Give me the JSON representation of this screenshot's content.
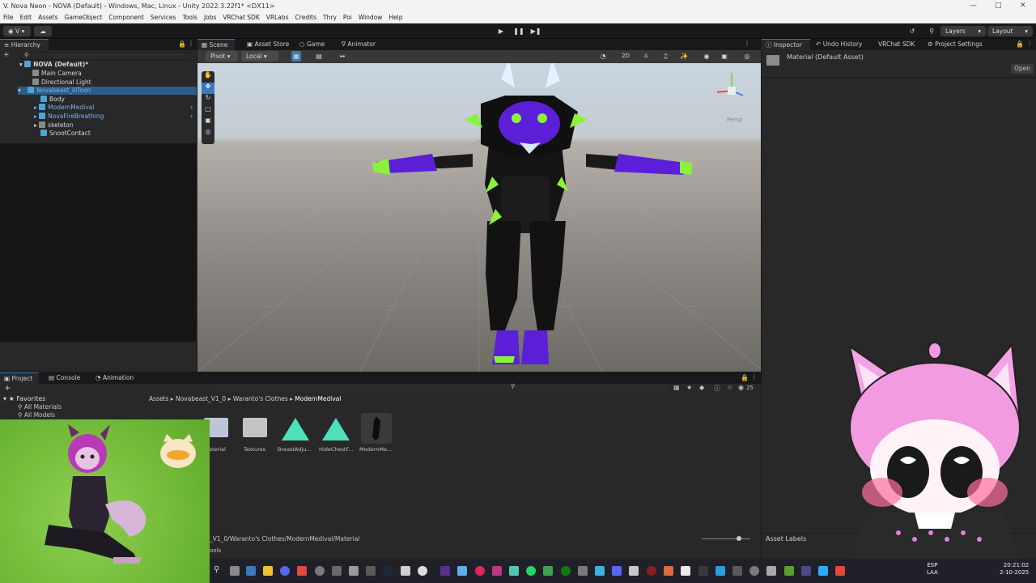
{
  "window": {
    "title": "V. Nova Neon - NOVA (Default) - Windows, Mac, Linux - Unity 2022.3.22f1* <DX11>"
  },
  "menu": [
    "File",
    "Edit",
    "Assets",
    "GameObject",
    "Component",
    "Services",
    "Tools",
    "Jobs",
    "VRChat SDK",
    "VRLabs",
    "Credits",
    "Thry",
    "Poi",
    "Window",
    "Help"
  ],
  "toolbar": {
    "account_label": "V",
    "layers_label": "Layers",
    "layout_label": "Layout"
  },
  "hierarchy": {
    "tab": "Hierarchy",
    "items": [
      {
        "label": "NOVA (Default)*"
      },
      {
        "label": "Main Camera"
      },
      {
        "label": "Directional Light"
      },
      {
        "label": "Novabeast_lilToon"
      },
      {
        "label": "Body"
      },
      {
        "label": "ModernMedival"
      },
      {
        "label": "NovaFireBreathing"
      },
      {
        "label": "skeleton"
      },
      {
        "label": "SnootContact"
      }
    ]
  },
  "scene_tabs": [
    "Scene",
    "Asset Store",
    "Game",
    "Animator"
  ],
  "scene_toolbar": {
    "pivot": "Pivot",
    "local": "Local",
    "mode_2d": "2D",
    "persp": "Persp"
  },
  "inspector": {
    "tabs": [
      "Inspector",
      "Undo History",
      "VRChat SDK",
      "Project Settings"
    ],
    "asset_title": "Material (Default Asset)",
    "open_button": "Open",
    "asset_labels": "Asset Labels"
  },
  "project": {
    "tabs": [
      "Project",
      "Console",
      "Animation"
    ],
    "favorites_label": "Favorites",
    "favorites": [
      "All Materials",
      "All Models"
    ],
    "breadcrumb": [
      "Assets",
      "Novabeast_V1_0",
      "Waranto's Clothes",
      "ModernMedival"
    ],
    "assets": [
      {
        "name": "aterial",
        "kind": "folder"
      },
      {
        "name": "Textures",
        "kind": "folder"
      },
      {
        "name": "BreastAdju...",
        "kind": "shader"
      },
      {
        "name": "HideChestF...",
        "kind": "shader"
      },
      {
        "name": "ModernMe...",
        "kind": "model"
      }
    ],
    "path": "_V1_0/Waranto's Clothes/ModernMedival/Material",
    "status": "ools",
    "count_badge": "25"
  },
  "taskbar": {
    "lang_top": "ESP",
    "lang_bottom": "LAA",
    "time": "20:21:02",
    "date": "2-10-2025"
  },
  "colors": {
    "accent": "#3a79bb",
    "prefab_text": "#7bb3ea",
    "neon_green": "#8bf23a",
    "purple": "#6a1fd8"
  }
}
